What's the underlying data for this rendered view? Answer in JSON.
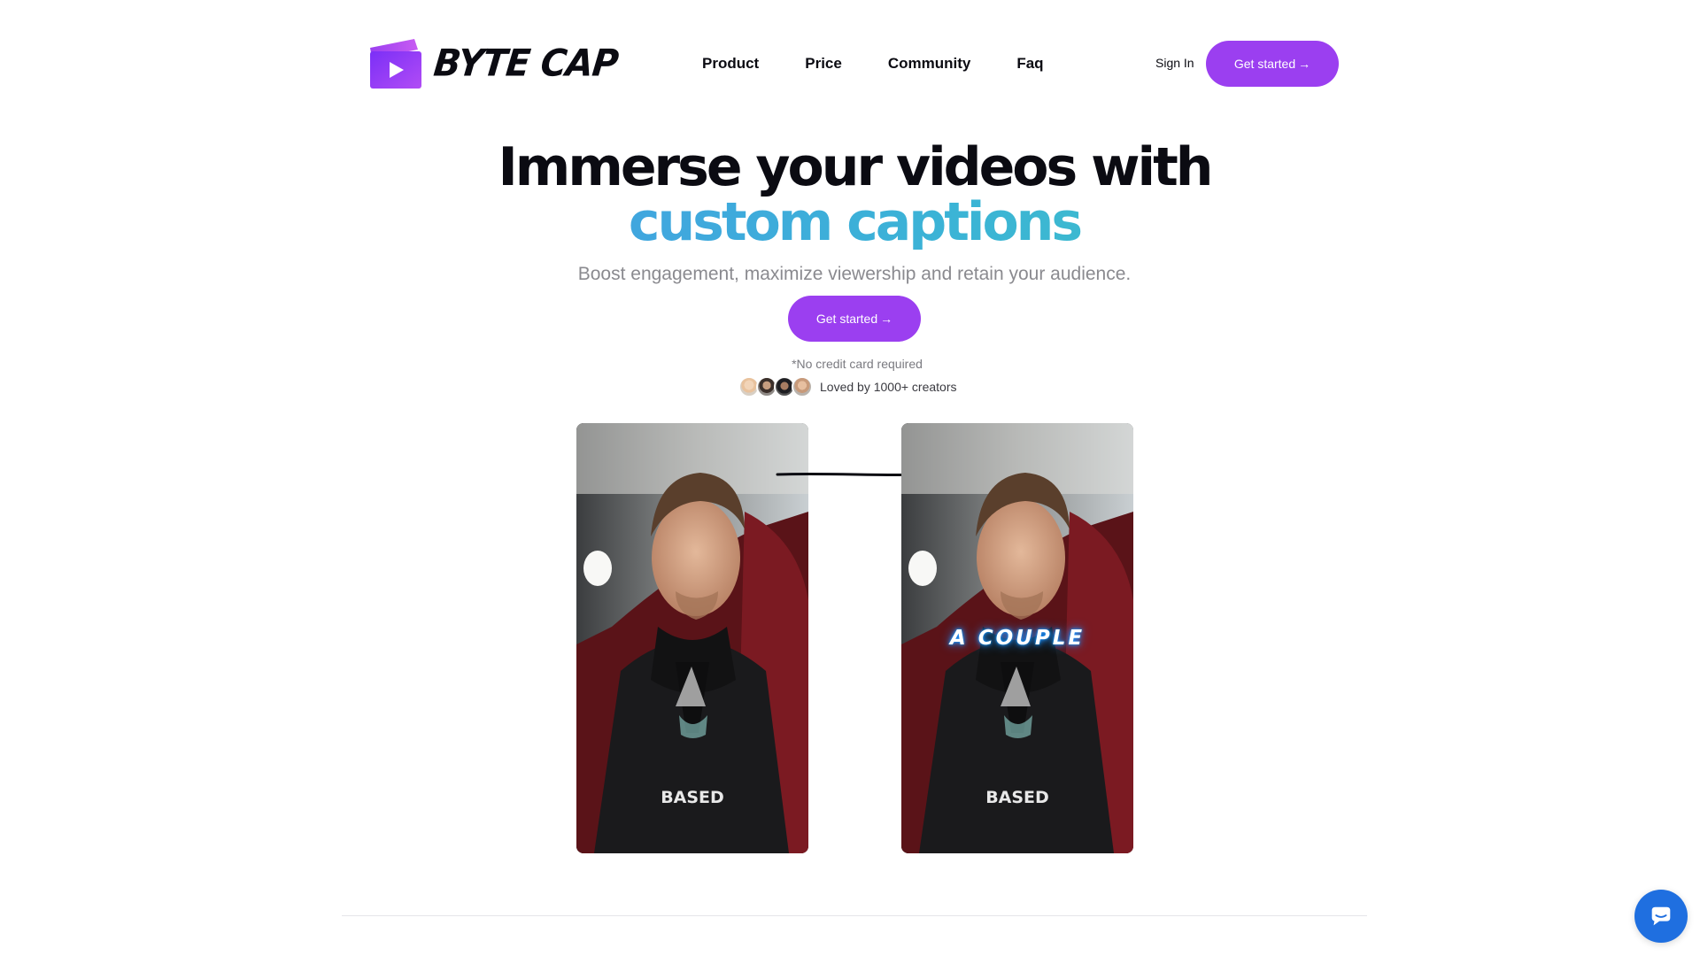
{
  "brand": {
    "name": "BYTE CAP",
    "accent": "#9b3ff0",
    "logo_icon": "play-icon"
  },
  "nav": {
    "items": [
      {
        "label": "Product"
      },
      {
        "label": "Price"
      },
      {
        "label": "Community"
      },
      {
        "label": "Faq"
      }
    ],
    "sign_in": "Sign In",
    "cta": "Get started",
    "cta_icon": "arrow-right-icon"
  },
  "hero": {
    "title_line1": "Immerse your videos with",
    "title_line2": "custom captions",
    "subtitle": "Boost engagement, maximize viewership and retain your audience.",
    "cta": "Get started",
    "note": "*No credit card required",
    "social_proof": "Loved by 1000+ creators",
    "gradient_colors": [
      "#4b8cf0",
      "#3bb3d6",
      "#3fd0b8"
    ]
  },
  "videos": {
    "before": {
      "shirt_text": "BASED"
    },
    "after": {
      "caption": "A COUPLE",
      "shirt_text": "BASED",
      "caption_glow": "#1e90ff"
    }
  },
  "chat": {
    "icon": "chat-icon",
    "color": "#1f6fe0"
  }
}
